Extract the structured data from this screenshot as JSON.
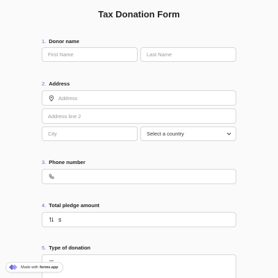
{
  "form": {
    "title": "Tax Donation Form"
  },
  "donor_name": {
    "number": "1.",
    "label": "Donor name",
    "first_placeholder": "First Name",
    "last_placeholder": "Last Name"
  },
  "address": {
    "number": "2.",
    "label": "Address",
    "line1_placeholder": "Address",
    "line2_placeholder": "Address line 2",
    "city_placeholder": "City",
    "country_select": "Select a country"
  },
  "phone": {
    "number": "3.",
    "label": "Phone number"
  },
  "pledge": {
    "number": "4.",
    "label": "Total pledge amount",
    "currency": "$"
  },
  "donation_type": {
    "number": "5.",
    "label": "Type of donation"
  },
  "footer": {
    "made_with": "Made with",
    "brand": "forms.app"
  },
  "colors": {
    "accent": "#6b63d8",
    "border": "#d8d8d8",
    "background": "#fafafa"
  },
  "icons": {
    "address": "location-pin-icon",
    "phone": "phone-icon",
    "pledge": "sort-arrows-icon",
    "donation": "list-icon",
    "select": "chevron-down-icon"
  }
}
